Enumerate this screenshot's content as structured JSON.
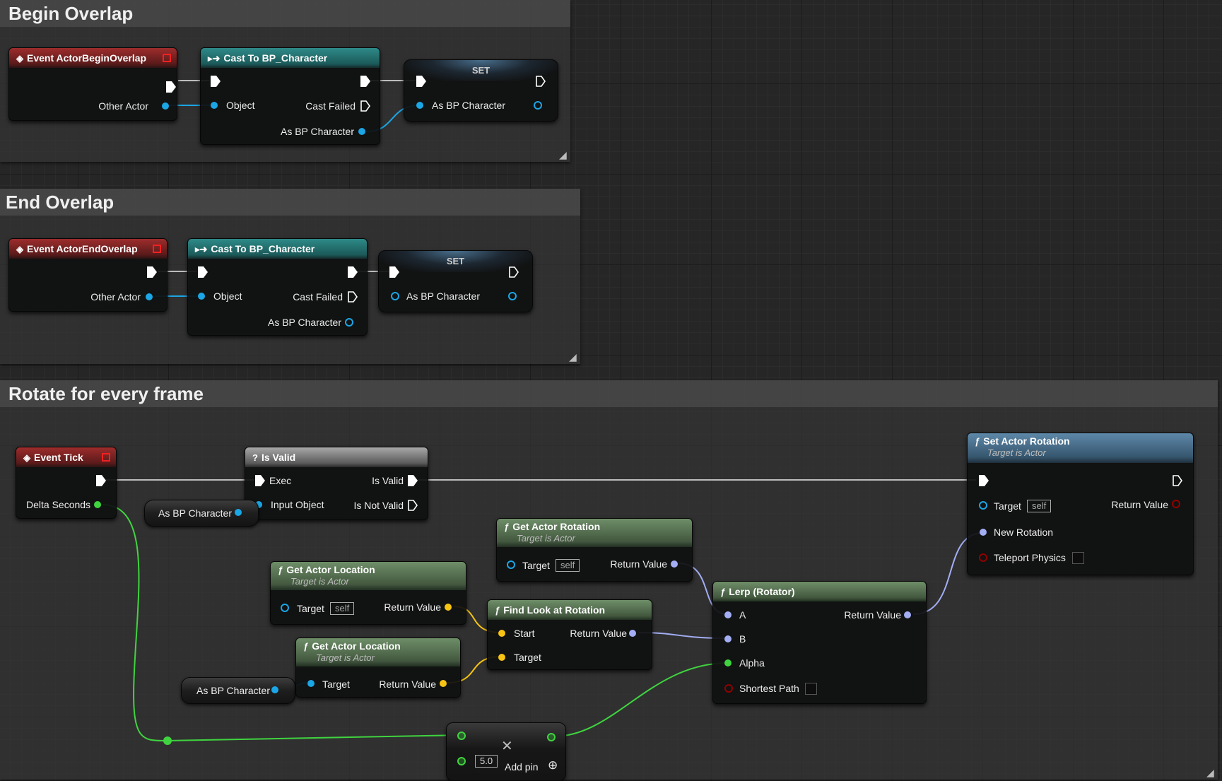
{
  "comments": {
    "begin_overlap": "Begin Overlap",
    "end_overlap": "End Overlap",
    "rotate": "Rotate for every frame"
  },
  "colors": {
    "object_pin": "#1ba6e6",
    "float_pin": "#3fd43f",
    "vector_pin": "#f7c413",
    "rotator_pin": "#a3aef5",
    "bool_pin": "#910000",
    "exec_pin": "#ffffff"
  },
  "nodes": {
    "event_begin_overlap": {
      "title": "Event ActorBeginOverlap",
      "other_actor": "Other Actor"
    },
    "cast1": {
      "title": "Cast To BP_Character",
      "object": "Object",
      "cast_failed": "Cast Failed",
      "as_bp_character": "As BP Character"
    },
    "set1": {
      "title": "SET",
      "as_bp_character": "As BP Character"
    },
    "event_end_overlap": {
      "title": "Event ActorEndOverlap",
      "other_actor": "Other Actor"
    },
    "cast2": {
      "title": "Cast To BP_Character",
      "object": "Object",
      "cast_failed": "Cast Failed",
      "as_bp_character": "As BP Character"
    },
    "set2": {
      "title": "SET",
      "as_bp_character": "As BP Character"
    },
    "event_tick": {
      "title": "Event Tick",
      "delta_seconds": "Delta Seconds"
    },
    "is_valid": {
      "title": "Is Valid",
      "exec": "Exec",
      "is_valid": "Is Valid",
      "input_object": "Input Object",
      "is_not_valid": "Is Not Valid"
    },
    "var_get_1": {
      "label": "As BP Character"
    },
    "var_get_2": {
      "label": "As BP Character"
    },
    "set_actor_rotation": {
      "title": "Set Actor Rotation",
      "subtitle": "Target is Actor",
      "target": "Target",
      "target_value": "self",
      "return_value": "Return Value",
      "new_rotation": "New Rotation",
      "teleport_physics": "Teleport Physics"
    },
    "get_actor_rotation": {
      "title": "Get Actor Rotation",
      "subtitle": "Target is Actor",
      "target": "Target",
      "target_value": "self",
      "return_value": "Return Value"
    },
    "get_actor_location_1": {
      "title": "Get Actor Location",
      "subtitle": "Target is Actor",
      "target": "Target",
      "target_value": "self",
      "return_value": "Return Value"
    },
    "get_actor_location_2": {
      "title": "Get Actor Location",
      "subtitle": "Target is Actor",
      "target": "Target",
      "return_value": "Return Value"
    },
    "find_look_at": {
      "title": "Find Look at Rotation",
      "start": "Start",
      "target": "Target",
      "return_value": "Return Value"
    },
    "lerp": {
      "title": "Lerp (Rotator)",
      "a": "A",
      "b": "B",
      "alpha": "Alpha",
      "shortest_path": "Shortest Path",
      "return_value": "Return Value"
    },
    "multiply": {
      "value": "5.0",
      "add_pin": "Add pin"
    }
  }
}
